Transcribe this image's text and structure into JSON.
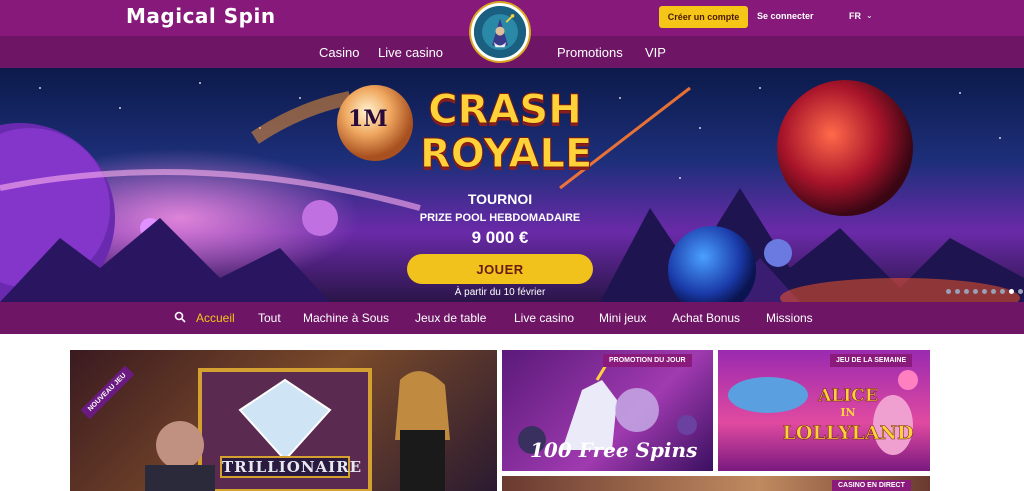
{
  "header": {
    "brand": "Magical Spin",
    "create_account": "Créer un compte",
    "login": "Se connecter",
    "language": "FR"
  },
  "nav": {
    "items": [
      "Casino",
      "Live casino",
      "Promotions",
      "VIP"
    ]
  },
  "hero": {
    "title_line1": "CRASH",
    "title_line2": "ROYALE",
    "subtitle": "TOURNOI",
    "prize_label": "PRIZE POOL HEBDOMADAIRE",
    "prize_amount": "9 000 €",
    "cta": "JOUER",
    "date_note": "À partir du 10 février",
    "logo_text": "1M",
    "slides": 9,
    "active_slide": 7
  },
  "categories": {
    "items": [
      "Accueil",
      "Tout",
      "Machine à Sous",
      "Jeux de table",
      "Live casino",
      "Mini jeux",
      "Achat Bonus",
      "Missions"
    ],
    "active": "Accueil"
  },
  "cards": {
    "new_game": {
      "badge": "NOUVEAU JEU",
      "title": "TRILLIONAIRE"
    },
    "promo": {
      "badge": "PROMOTION DU JOUR",
      "title": "100 Free Spins"
    },
    "weekly": {
      "badge": "JEU DE LA SEMAINE",
      "title_line1": "ALICE",
      "title_line2": "IN",
      "title_line3": "LOLLYLAND"
    },
    "live": {
      "badge": "CASINO EN DIRECT"
    }
  },
  "colors": {
    "topbar": "#86197a",
    "navbar": "#6e1566",
    "accent": "#f5c518"
  }
}
